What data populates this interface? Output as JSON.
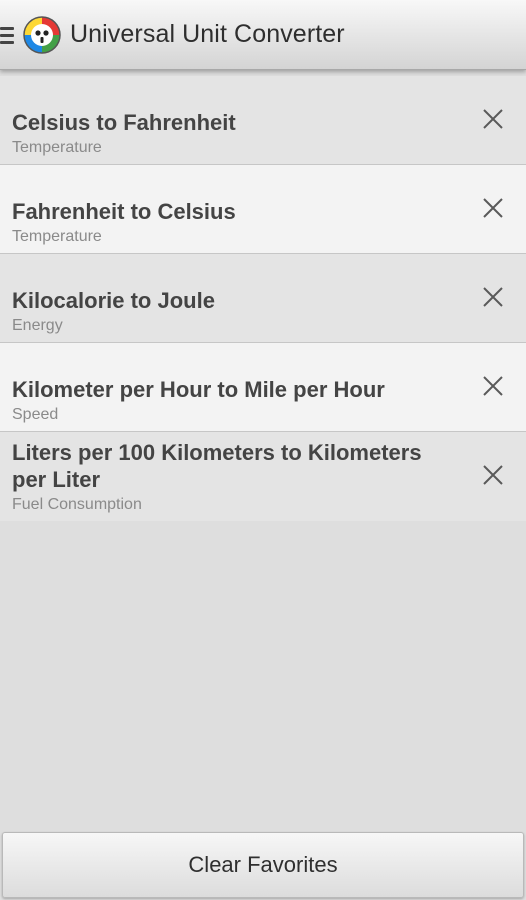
{
  "app": {
    "title": "Universal Unit Converter",
    "menu_icon": "menu-icon",
    "logo_icon": "app-logo-icon"
  },
  "favorites": [
    {
      "title": "Celsius to Fahrenheit",
      "category": "Temperature",
      "remove_icon": "close-icon"
    },
    {
      "title": "Fahrenheit to Celsius",
      "category": "Temperature",
      "remove_icon": "close-icon"
    },
    {
      "title": "Kilocalorie to Joule",
      "category": "Energy",
      "remove_icon": "close-icon"
    },
    {
      "title": "Kilometer per Hour to Mile per Hour",
      "category": "Speed",
      "remove_icon": "close-icon"
    },
    {
      "title": "Liters per 100 Kilometers to Kilometers per Liter",
      "category": "Fuel Consumption",
      "remove_icon": "close-icon"
    }
  ],
  "footer": {
    "clear_label": "Clear Favorites"
  },
  "colors": {
    "background": "#dedede",
    "row_dark": "#e4e4e4",
    "row_light": "#f3f3f3",
    "title_text": "#444444",
    "subtitle_text": "#8a8a8a"
  }
}
